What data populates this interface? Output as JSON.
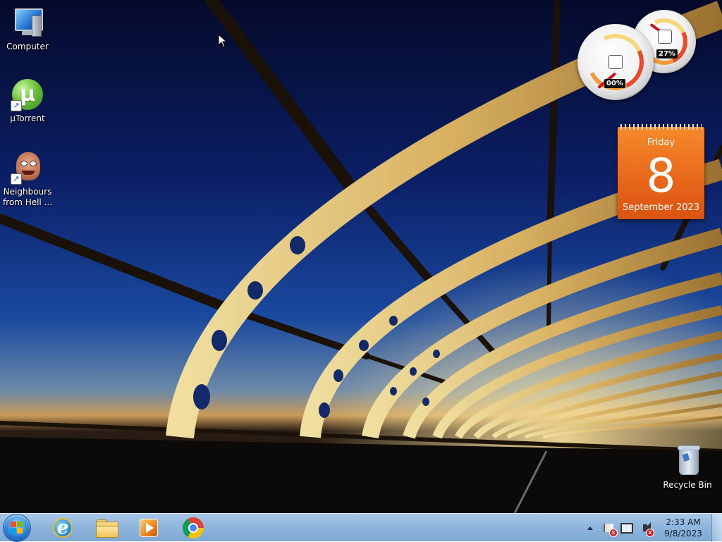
{
  "desktop_icons": [
    {
      "label": "Computer",
      "icon": "computer-icon"
    },
    {
      "label": "µTorrent",
      "icon": "utorrent-icon"
    },
    {
      "label": "Neighbours from Hell ...",
      "icon": "game-face-icon"
    },
    {
      "label": "Recycle Bin",
      "icon": "recycle-bin-icon"
    }
  ],
  "gadgets": {
    "cpu_meter": {
      "cpu_usage": "00%",
      "memory_usage": "27%",
      "cpu_level": 0.0,
      "memory_level": 0.27
    },
    "calendar": {
      "day_of_week": "Friday",
      "day": "8",
      "month_year": "September 2023",
      "color": "#f07a20"
    }
  },
  "taskbar": {
    "start": {
      "icon": "windows-start-orb-icon"
    },
    "pinned": [
      {
        "name": "Internet Explorer",
        "icon": "internet-explorer-icon"
      },
      {
        "name": "Windows Explorer",
        "icon": "folder-icon"
      },
      {
        "name": "Windows Media Player",
        "icon": "media-player-icon"
      },
      {
        "name": "Google Chrome",
        "icon": "chrome-icon"
      }
    ],
    "tray": {
      "icons": [
        "show-hidden-icons-icon",
        "action-center-flag-icon",
        "network-icon",
        "volume-muted-icon"
      ],
      "time": "2:33 AM",
      "date": "9/8/2023"
    }
  },
  "colors": {
    "taskbar": "#8fb6dd",
    "calendar": "#f07a20",
    "gauge_needle": "#c8141e"
  }
}
